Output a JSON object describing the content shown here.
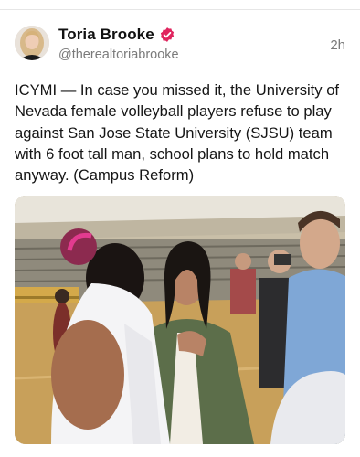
{
  "post": {
    "author": {
      "display_name": "Toria Brooke",
      "handle": "@therealtoriabrooke",
      "verified": true,
      "avatar_icon": "profile-photo",
      "verified_icon": "verified-badge-icon"
    },
    "timestamp": "2h",
    "text": "ICYMI — In case you missed it, the University of Nevada female volleyball players refuse to play against San Jose State University (SJSU) team with 6 foot tall man, school plans to hold match anyway. (Campus Reform)",
    "media": {
      "type": "photo"
    }
  },
  "colors": {
    "verified_badge": "#e0245e",
    "secondary_text": "#7a7a7a",
    "divider": "#e6e6e6"
  }
}
